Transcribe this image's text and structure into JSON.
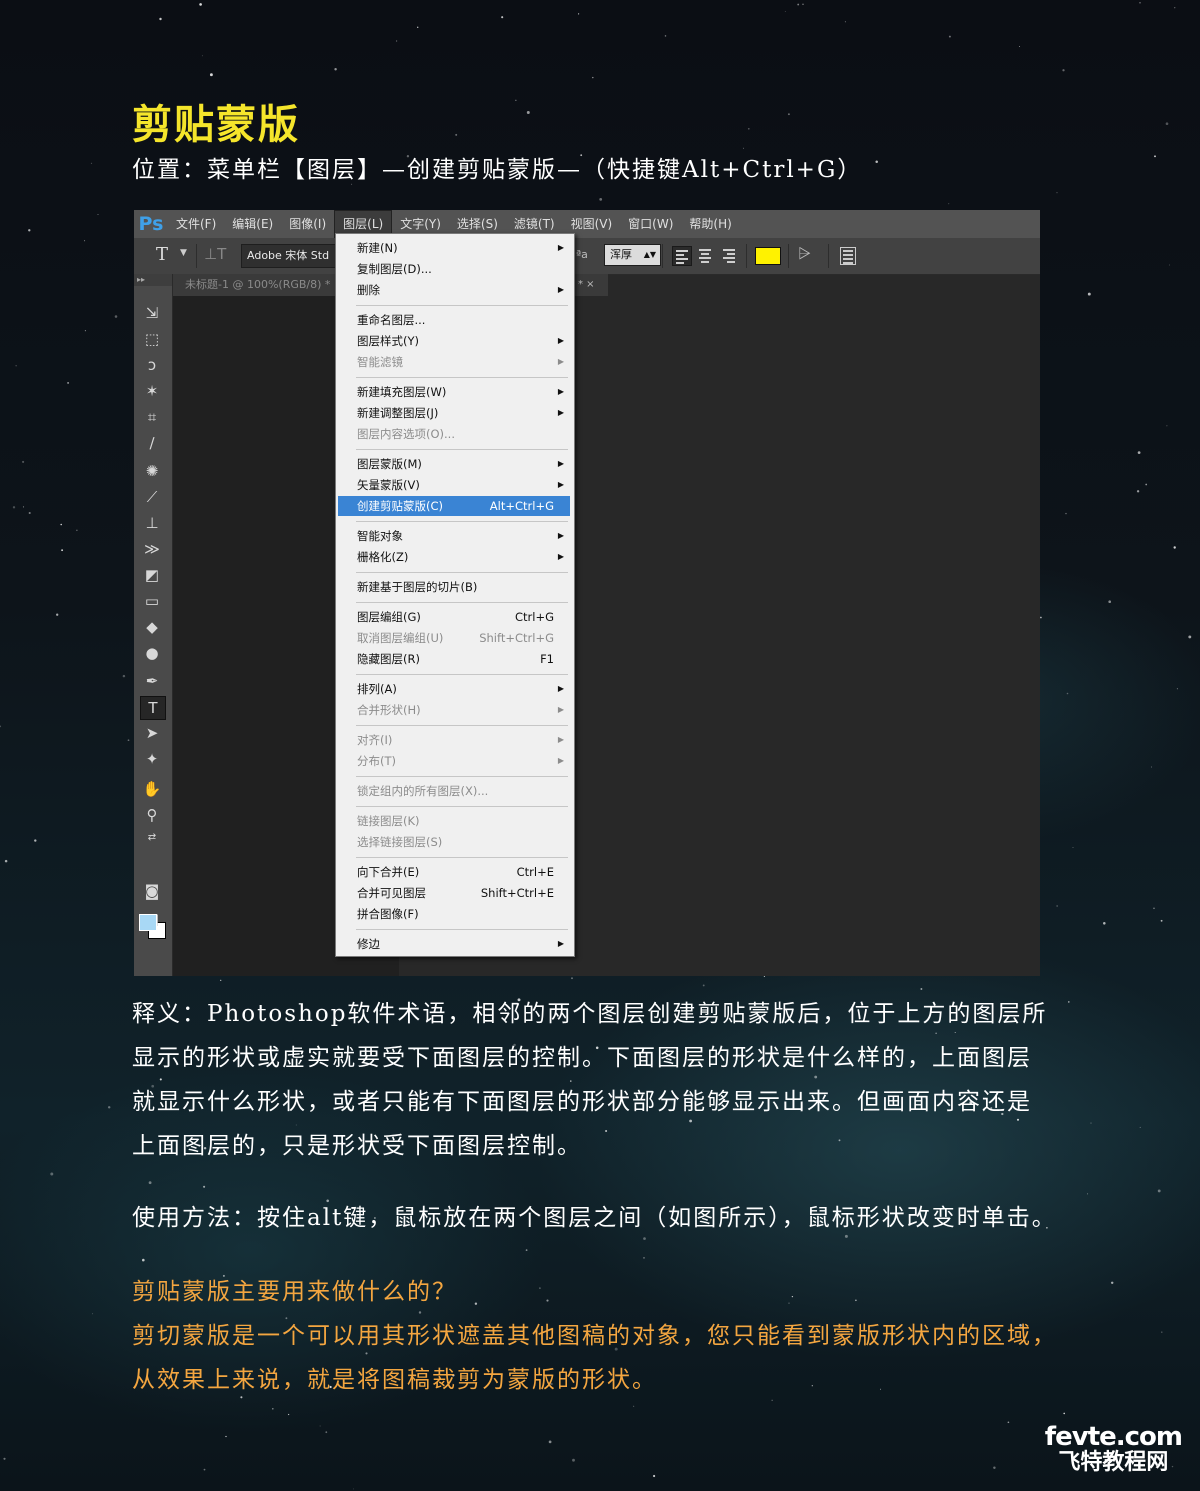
{
  "heading": {
    "title": "剪贴蒙版",
    "location": "位置：菜单栏【图层】—创建剪贴蒙版—（快捷键Alt+Ctrl+G）"
  },
  "photoshop": {
    "logo": "Ps",
    "menubar": [
      "文件(F)",
      "编辑(E)",
      "图像(I)",
      "图层(L)",
      "文字(Y)",
      "选择(S)",
      "滤镜(T)",
      "视图(V)",
      "窗口(W)",
      "帮助(H)"
    ],
    "active_menu": "图层(L)",
    "options": {
      "tool_glyph": "T",
      "font_family": "Adobe 宋体 Std",
      "aa_prefix": "ªa",
      "antialias": "浑厚",
      "text_color": "#fff200"
    },
    "doc_tab": "未标题-1 @ 100%(RGB/8) *",
    "doc_tab2": "* ×",
    "layer_menu": [
      {
        "label": "新建(N)",
        "submenu": true
      },
      {
        "label": "复制图层(D)..."
      },
      {
        "label": "删除",
        "submenu": true
      },
      {
        "separator": true
      },
      {
        "label": "重命名图层..."
      },
      {
        "label": "图层样式(Y)",
        "submenu": true
      },
      {
        "label": "智能滤镜",
        "submenu": true,
        "disabled": true
      },
      {
        "separator": true
      },
      {
        "label": "新建填充图层(W)",
        "submenu": true
      },
      {
        "label": "新建调整图层(J)",
        "submenu": true
      },
      {
        "label": "图层内容选项(O)...",
        "disabled": true
      },
      {
        "separator": true
      },
      {
        "label": "图层蒙版(M)",
        "submenu": true
      },
      {
        "label": "矢量蒙版(V)",
        "submenu": true
      },
      {
        "label": "创建剪贴蒙版(C)",
        "shortcut": "Alt+Ctrl+G",
        "highlighted": true
      },
      {
        "separator": true
      },
      {
        "label": "智能对象",
        "submenu": true
      },
      {
        "label": "栅格化(Z)",
        "submenu": true
      },
      {
        "separator": true
      },
      {
        "label": "新建基于图层的切片(B)"
      },
      {
        "separator": true
      },
      {
        "label": "图层编组(G)",
        "shortcut": "Ctrl+G"
      },
      {
        "label": "取消图层编组(U)",
        "shortcut": "Shift+Ctrl+G",
        "disabled": true
      },
      {
        "label": "隐藏图层(R)",
        "shortcut": "F1"
      },
      {
        "separator": true
      },
      {
        "label": "排列(A)",
        "submenu": true
      },
      {
        "label": "合并形状(H)",
        "submenu": true,
        "disabled": true
      },
      {
        "separator": true
      },
      {
        "label": "对齐(I)",
        "submenu": true,
        "disabled": true
      },
      {
        "label": "分布(T)",
        "submenu": true,
        "disabled": true
      },
      {
        "separator": true
      },
      {
        "label": "锁定组内的所有图层(X)...",
        "disabled": true
      },
      {
        "separator": true
      },
      {
        "label": "链接图层(K)",
        "disabled": true
      },
      {
        "label": "选择链接图层(S)",
        "disabled": true
      },
      {
        "separator": true
      },
      {
        "label": "向下合并(E)",
        "shortcut": "Ctrl+E"
      },
      {
        "label": "合并可见图层",
        "shortcut": "Shift+Ctrl+E"
      },
      {
        "label": "拼合图像(F)"
      },
      {
        "separator": true
      },
      {
        "label": "修边",
        "submenu": true
      }
    ]
  },
  "body": {
    "definition": [
      "释义：Photoshop软件术语，相邻的两个图层创建剪贴蒙版后，位于上方的图层所",
      "显示的形状或虚实就要受下面图层的控制。下面图层的形状是什么样的，上面图层",
      "就显示什么形状，或者只能有下面图层的形状部分能够显示出来。但画面内容还是",
      "上面图层的，只是形状受下面图层控制。"
    ],
    "usage": "使用方法：按住alt键，鼠标放在两个图层之间（如图所示），鼠标形状改变时单击。",
    "faq": [
      "剪贴蒙版主要用来做什么的？",
      "剪切蒙版是一个可以用其形状遮盖其他图稿的对象，您只能看到蒙版形状内的区域，",
      "从效果上来说，就是将图稿裁剪为蒙版的形状。"
    ]
  },
  "watermark": {
    "line1": "fevte.com",
    "line2": "飞特教程网"
  },
  "colors": {
    "title": "#f5e52b",
    "body_text": "#ffffff",
    "faq_text": "#f4a640",
    "menu_highlight": "#3a84d4"
  }
}
